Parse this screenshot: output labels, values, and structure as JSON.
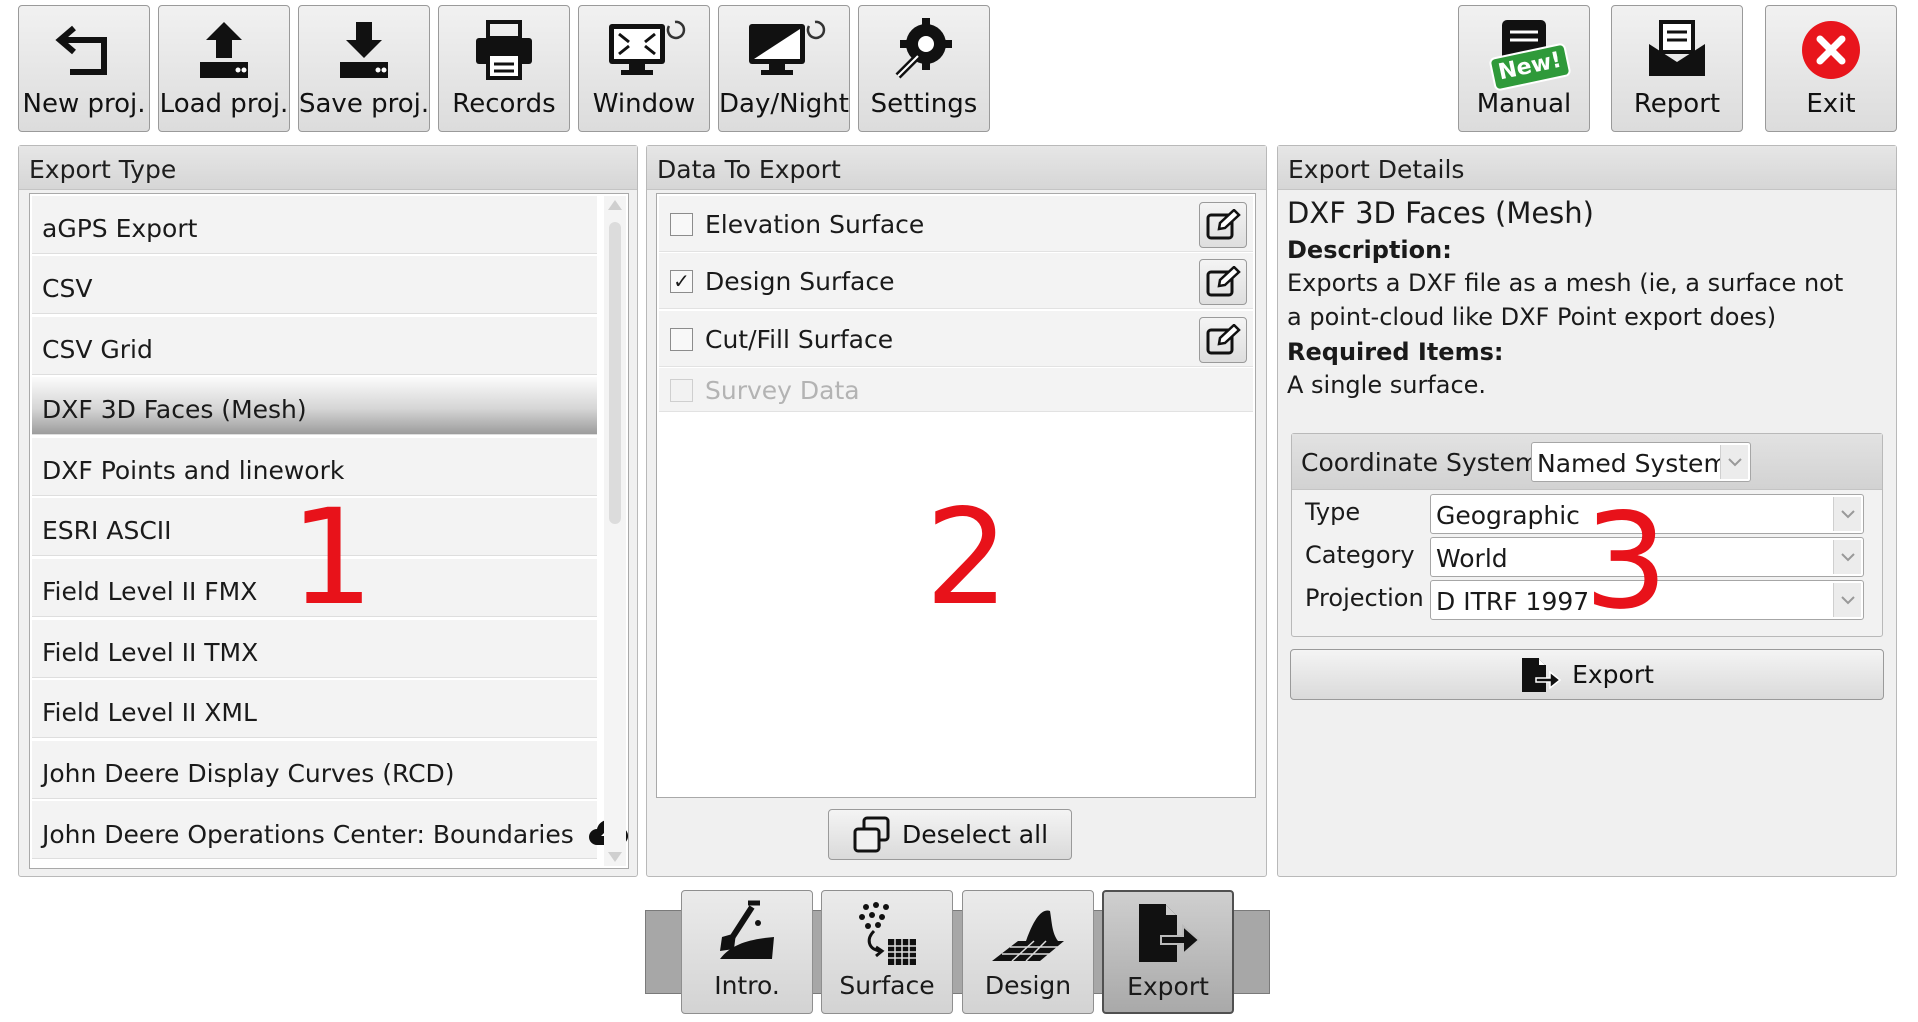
{
  "toolbar": {
    "new_proj": "New proj.",
    "load_proj": "Load proj.",
    "save_proj": "Save proj.",
    "records": "Records",
    "window": "Window",
    "day_night": "Day/Night",
    "settings": "Settings",
    "manual": "Manual",
    "manual_badge": "New!",
    "report": "Report",
    "exit": "Exit"
  },
  "export_type": {
    "header": "Export Type",
    "items": [
      "aGPS Export",
      "CSV",
      "CSV Grid",
      "DXF 3D Faces (Mesh)",
      "DXF Points and linework",
      "ESRI ASCII",
      "Field Level II FMX",
      "Field Level II TMX",
      "Field Level II XML",
      "John Deere Display Curves (RCD)",
      "John Deere Operations Center: Boundaries"
    ],
    "selected": "DXF 3D Faces (Mesh)"
  },
  "data_to_export": {
    "header": "Data To Export",
    "items": [
      {
        "label": "Elevation Surface",
        "checked": false,
        "enabled": true
      },
      {
        "label": "Design Surface",
        "checked": true,
        "enabled": true
      },
      {
        "label": "Cut/Fill Surface",
        "checked": false,
        "enabled": true
      },
      {
        "label": "Survey Data",
        "checked": false,
        "enabled": false
      }
    ],
    "deselect_all": "Deselect all"
  },
  "export_details": {
    "header": "Export Details",
    "title": "DXF 3D Faces (Mesh)",
    "description_label": "Description:",
    "description": "Exports a DXF file as a mesh (ie, a surface not a point-cloud like DXF Point export does)",
    "required_label": "Required Items:",
    "required": "A single surface.",
    "coordinate_system": {
      "label": "Coordinate System",
      "mode": "Named System",
      "type_label": "Type",
      "type_value": "Geographic",
      "category_label": "Category",
      "category_value": "World",
      "projection_label": "Projection",
      "projection_value": "D ITRF 1997"
    },
    "export_button": "Export"
  },
  "tabs": [
    "Intro.",
    "Surface",
    "Design",
    "Export"
  ],
  "active_tab": "Export",
  "annotations": [
    "1",
    "2",
    "3"
  ],
  "colors": {
    "annotation": "#e8121a",
    "exit_icon": "#e8151c",
    "badge": "#2f9a3a"
  }
}
